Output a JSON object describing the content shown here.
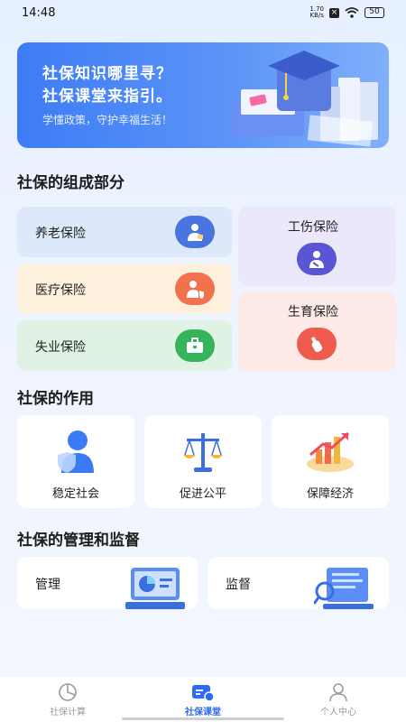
{
  "status_bar": {
    "time": "14:48",
    "net_speed_value": "1.70",
    "net_speed_unit": "KB/s",
    "battery": "50"
  },
  "banner": {
    "line1": "社保知识哪里寻？",
    "line2": "社保课堂来指引。",
    "subtitle": "学懂政策，守护幸福生活！"
  },
  "composition": {
    "title": "社保的组成部分",
    "items": [
      {
        "label": "养老保险",
        "icon": "elderly-person-icon",
        "bg": "#dde9fb",
        "accent": "#4a74e0"
      },
      {
        "label": "医疗保险",
        "icon": "medical-person-icon",
        "bg": "#fdf1dd",
        "accent": "#f0734e"
      },
      {
        "label": "失业保险",
        "icon": "briefcase-icon",
        "bg": "#dff2e4",
        "accent": "#35b55a"
      },
      {
        "label": "工伤保险",
        "icon": "injured-person-icon",
        "bg": "#ece8fb",
        "accent": "#5a55d4"
      },
      {
        "label": "生育保险",
        "icon": "baby-bottle-icon",
        "bg": "#fde9e6",
        "accent": "#ef5b4c"
      }
    ]
  },
  "functions": {
    "title": "社保的作用",
    "items": [
      {
        "label": "稳定社会",
        "icon": "person-shield-icon"
      },
      {
        "label": "促进公平",
        "icon": "balance-scale-icon"
      },
      {
        "label": "保障经济",
        "icon": "growth-chart-icon"
      }
    ]
  },
  "management": {
    "title": "社保的管理和监督",
    "items": [
      {
        "label": "管理",
        "icon": "monitor-chart-icon"
      },
      {
        "label": "监督",
        "icon": "document-search-icon"
      }
    ]
  },
  "nav": {
    "items": [
      {
        "label": "社保计算",
        "icon": "pie-chart-icon",
        "active": false
      },
      {
        "label": "社保课堂",
        "icon": "classroom-icon",
        "active": true
      },
      {
        "label": "个人中心",
        "icon": "person-icon",
        "active": false
      }
    ]
  },
  "colors": {
    "primary": "#2f6bf2",
    "banner": "#4a86f6"
  }
}
